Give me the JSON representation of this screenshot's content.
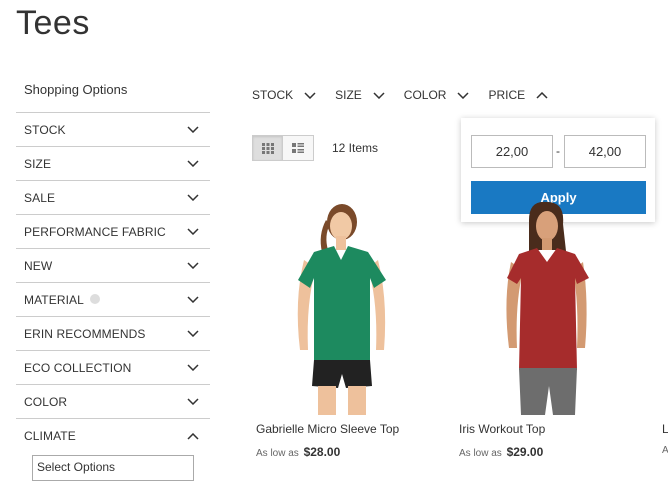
{
  "page": {
    "title": "Tees"
  },
  "sidebar": {
    "title": "Shopping Options",
    "filters": [
      {
        "label": "STOCK",
        "state": "collapsed"
      },
      {
        "label": "SIZE",
        "state": "collapsed"
      },
      {
        "label": "SALE",
        "state": "collapsed"
      },
      {
        "label": "PERFORMANCE FABRIC",
        "state": "collapsed"
      },
      {
        "label": "NEW",
        "state": "collapsed"
      },
      {
        "label": "MATERIAL",
        "state": "collapsed",
        "has_help_icon": true
      },
      {
        "label": "ERIN RECOMMENDS",
        "state": "collapsed"
      },
      {
        "label": "ECO COLLECTION",
        "state": "collapsed"
      },
      {
        "label": "COLOR",
        "state": "collapsed"
      },
      {
        "label": "CLIMATE",
        "state": "expanded"
      }
    ],
    "climate_select": {
      "value": "Select Options"
    }
  },
  "toolbar": {
    "filters": [
      {
        "label": "STOCK",
        "state": "collapsed"
      },
      {
        "label": "SIZE",
        "state": "collapsed"
      },
      {
        "label": "COLOR",
        "state": "collapsed"
      },
      {
        "label": "PRICE",
        "state": "expanded"
      }
    ],
    "view_modes": [
      {
        "name": "grid",
        "active": true
      },
      {
        "name": "list",
        "active": false
      }
    ],
    "item_count": "12 Items"
  },
  "price_popup": {
    "from_value": "22,00",
    "separator": "-",
    "to_value": "42,00",
    "apply_label": "Apply"
  },
  "products": [
    {
      "name": "Gabrielle Micro Sleeve Top",
      "price_prefix": "As low as",
      "price": "$28.00",
      "shirt_color": "#1d8a5f"
    },
    {
      "name": "Iris Workout Top",
      "price_prefix": "As low as",
      "price": "$29.00",
      "shirt_color": "#a62c2c"
    },
    {
      "name": "L",
      "price_prefix": "As",
      "price": ""
    }
  ],
  "colors": {
    "accent": "#1979c3",
    "border": "#cccccc",
    "text": "#333333"
  }
}
